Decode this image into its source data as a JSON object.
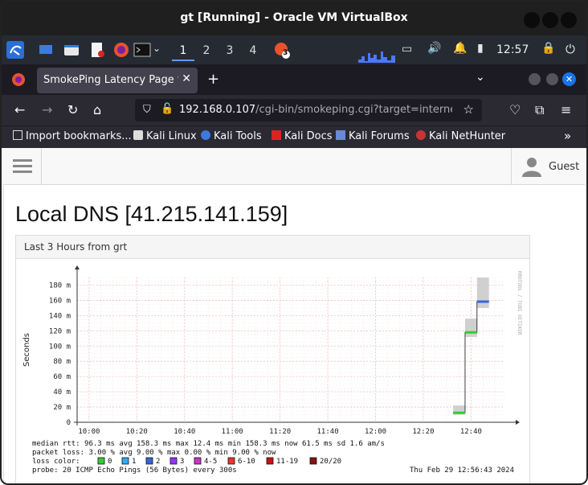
{
  "window": {
    "title": "gt [Running] - Oracle VM VirtualBox"
  },
  "panel": {
    "workspaces": [
      "1",
      "2",
      "3",
      "4"
    ],
    "active_workspace": "1",
    "task_badge": "3",
    "clock": "12:57"
  },
  "browser": {
    "tab_title": "SmokePing Latency Page for",
    "url_host": "192.168.0.107",
    "url_path": "/cgi-bin/smokeping.cgi?target=internet.G",
    "bookmarks": [
      "Import bookmarks...",
      "Kali Linux",
      "Kali Tools",
      "Kali Docs",
      "Kali Forums",
      "Kali NetHunter"
    ],
    "overflow_label": "»"
  },
  "page": {
    "user_label": "Guest",
    "title": "Local DNS [41.215.141.159]",
    "graph_panel_title": "Last 3 Hours from grt"
  },
  "chart_data": {
    "type": "line",
    "ylabel": "Seconds",
    "y_ticks": [
      "0",
      "20 m",
      "40 m",
      "60 m",
      "80 m",
      "100 m",
      "120 m",
      "140 m",
      "160 m",
      "180 m"
    ],
    "ylim": [
      0,
      190
    ],
    "x_ticks": [
      "10:00",
      "10:20",
      "10:40",
      "11:00",
      "11:20",
      "11:40",
      "12:00",
      "12:20",
      "12:40"
    ],
    "watermark": "RRDTOOL / TOBI OETIKER",
    "series": [
      {
        "name": "median rtt",
        "points": [
          {
            "time": "12:35",
            "value": 12.4,
            "loss_color": "#33cc33"
          },
          {
            "time": "12:40",
            "value": 118,
            "loss_color": "#33cc33"
          },
          {
            "time": "12:45",
            "value": 158.3,
            "loss_color": "#3366dd"
          }
        ]
      }
    ],
    "smoke": [
      {
        "time": "12:35",
        "min": 10,
        "max": 22
      },
      {
        "time": "12:40",
        "min": 112,
        "max": 136
      },
      {
        "time": "12:45",
        "min": 150,
        "max": 190
      }
    ],
    "stats": {
      "median_rtt": "median rtt:  96.3 ms avg  158.3 ms max  12.4 ms min  158.3 ms now  61.5 ms sd  1.6   am/s",
      "packet_loss": "packet loss: 3.00 % avg  9.00 % max  0.00 % min  9.00 % now",
      "loss_color_label": "loss color:",
      "legend": [
        {
          "label": "0",
          "color": "#33cc33"
        },
        {
          "label": "1",
          "color": "#33aaff"
        },
        {
          "label": "2",
          "color": "#3366dd"
        },
        {
          "label": "3",
          "color": "#9933ff"
        },
        {
          "label": "4-5",
          "color": "#cc33cc"
        },
        {
          "label": "6-10",
          "color": "#ee3333"
        },
        {
          "label": "11-19",
          "color": "#cc1111"
        },
        {
          "label": "20/20",
          "color": "#881111"
        }
      ],
      "probe": "probe:       20 ICMP Echo Pings (56 Bytes) every 300s",
      "timestamp": "Thu Feb 29 12:56:43 2024"
    }
  },
  "colors": {
    "vbox_title_bg": "#1f1f1f",
    "panel_bg": "#262a33",
    "firefox_dark": "#2b2a33",
    "grid_red": "#f2c4c4"
  }
}
